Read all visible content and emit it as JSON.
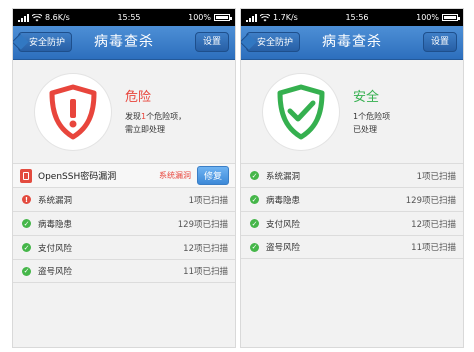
{
  "left": {
    "status_bar": {
      "carrier": "",
      "speed": "8.6K/s",
      "time": "15:55",
      "battery": "100%"
    },
    "nav": {
      "back_label": "安全防护",
      "title": "病毒查杀",
      "settings_label": "设置"
    },
    "hero": {
      "status": "危险",
      "line1_prefix": "发现",
      "line1_count": "1",
      "line1_suffix": "个危险项，",
      "line2": "需立即处理",
      "accent": "#e8453c",
      "icon": "shield-alert-icon"
    },
    "vuln": {
      "name": "OpenSSH密码漏洞",
      "tag": "系统漏洞",
      "fix_label": "修复"
    },
    "rows": [
      {
        "label": "系统漏洞",
        "value": "1项已扫描",
        "icon": "alert-icon"
      },
      {
        "label": "病毒隐患",
        "value": "129项已扫描",
        "icon": "check-icon"
      },
      {
        "label": "支付风险",
        "value": "12项已扫描",
        "icon": "check-icon"
      },
      {
        "label": "盗号风险",
        "value": "11项已扫描",
        "icon": "check-icon"
      }
    ]
  },
  "right": {
    "status_bar": {
      "carrier": "",
      "speed": "1.7K/s",
      "time": "15:56",
      "battery": "100%"
    },
    "nav": {
      "back_label": "安全防护",
      "title": "病毒查杀",
      "settings_label": "设置"
    },
    "hero": {
      "status": "安全",
      "line1": "1个危险项",
      "line2": "已处理",
      "accent": "#35b04f",
      "icon": "shield-check-icon"
    },
    "rows": [
      {
        "label": "系统漏洞",
        "value": "1项已扫描",
        "icon": "check-icon"
      },
      {
        "label": "病毒隐患",
        "value": "129项已扫描",
        "icon": "check-icon"
      },
      {
        "label": "支付风险",
        "value": "12项已扫描",
        "icon": "check-icon"
      },
      {
        "label": "盗号风险",
        "value": "11项已扫描",
        "icon": "check-icon"
      }
    ]
  }
}
